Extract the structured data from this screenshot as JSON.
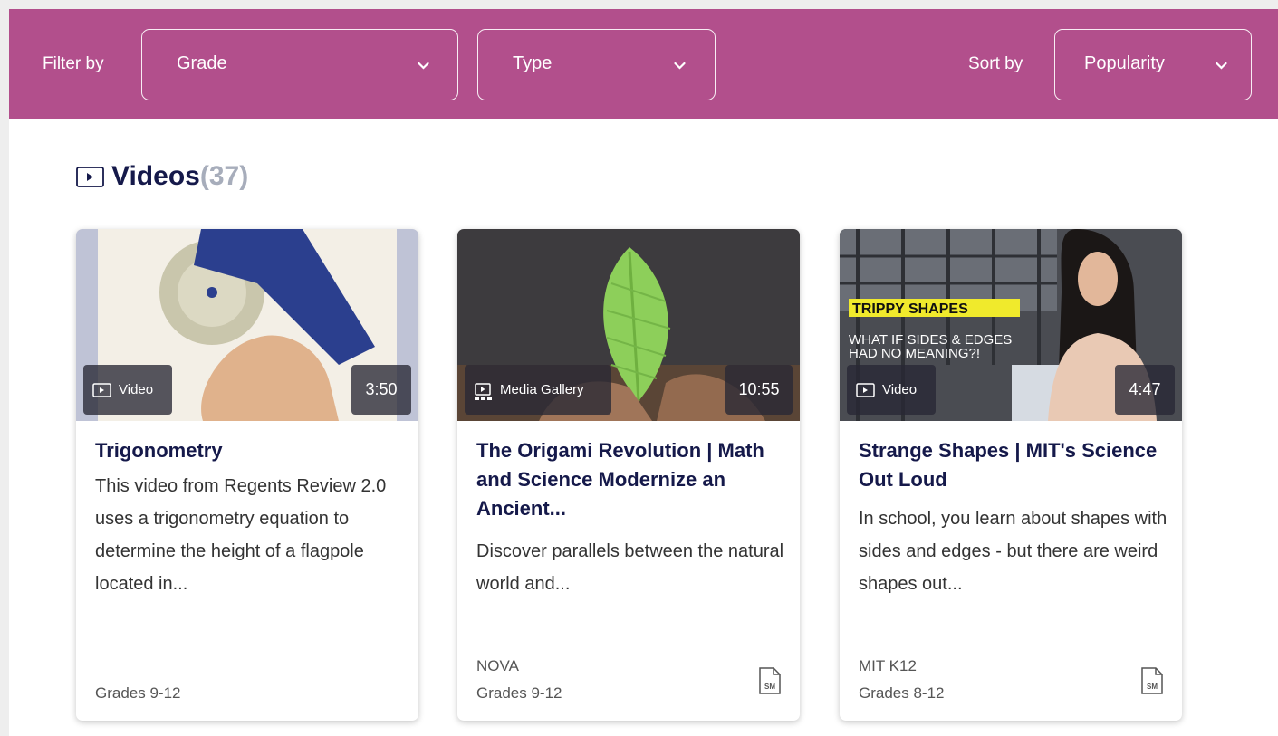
{
  "filters": {
    "filter_label": "Filter by",
    "grade": "Grade",
    "type": "Type",
    "sort_label": "Sort by",
    "sort": "Popularity"
  },
  "section": {
    "title": "Videos",
    "count": "(37)"
  },
  "cards": [
    {
      "title": "Trigonometry",
      "description": "This video from Regents Review 2.0 uses a trigonometry equation to determine the height of a flagpole located in...",
      "badge": "Video",
      "duration": "3:50",
      "source": "",
      "grades": "Grades 9-12",
      "icon": "video-icon"
    },
    {
      "title": "The Origami Revolution | Math and Science Modernize an Ancient...",
      "description": "Discover parallels between the natural world and...",
      "badge": "Media Gallery",
      "duration": "10:55",
      "source": "NOVA",
      "grades": "Grades 9-12",
      "icon": "media-gallery-icon",
      "support_icon": "sm-document-icon"
    },
    {
      "title": "Strange Shapes | MIT's Science Out Loud",
      "description": "In school, you learn about shapes with sides and edges - but there are weird shapes out...",
      "badge": "Video",
      "duration": "4:47",
      "source": "MIT K12",
      "grades": "Grades 8-12",
      "thumb_caption": "TRIPPY SHAPES",
      "thumb_subtitle_1": "WHAT IF SIDES & EDGES",
      "thumb_subtitle_2": "HAD NO MEANING?!",
      "icon": "video-icon",
      "support_icon": "sm-document-icon"
    }
  ],
  "colors": {
    "brand": "#b24f8c",
    "title": "#15194a",
    "count": "#a7adbb"
  }
}
